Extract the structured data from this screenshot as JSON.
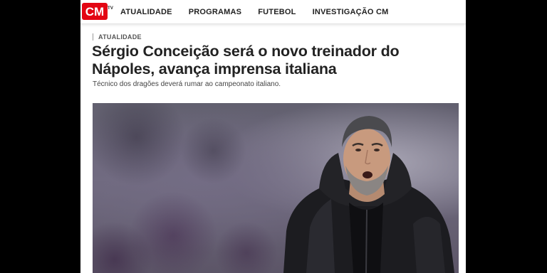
{
  "header": {
    "logo_text": "CM",
    "logo_suffix": "TV",
    "brand_color": "#e30613",
    "nav": [
      {
        "label": "ATUALIDADE"
      },
      {
        "label": "PROGRAMAS"
      },
      {
        "label": "FUTEBOL"
      },
      {
        "label": "INVESTIGAÇÃO CM"
      }
    ]
  },
  "article": {
    "kicker": "ATUALIDADE",
    "headline": "Sérgio Conceição será o novo treinador do Nápoles, avança imprensa italiana",
    "subtitle": "Técnico dos dragões deverá rumar ao campeonato italiano."
  }
}
